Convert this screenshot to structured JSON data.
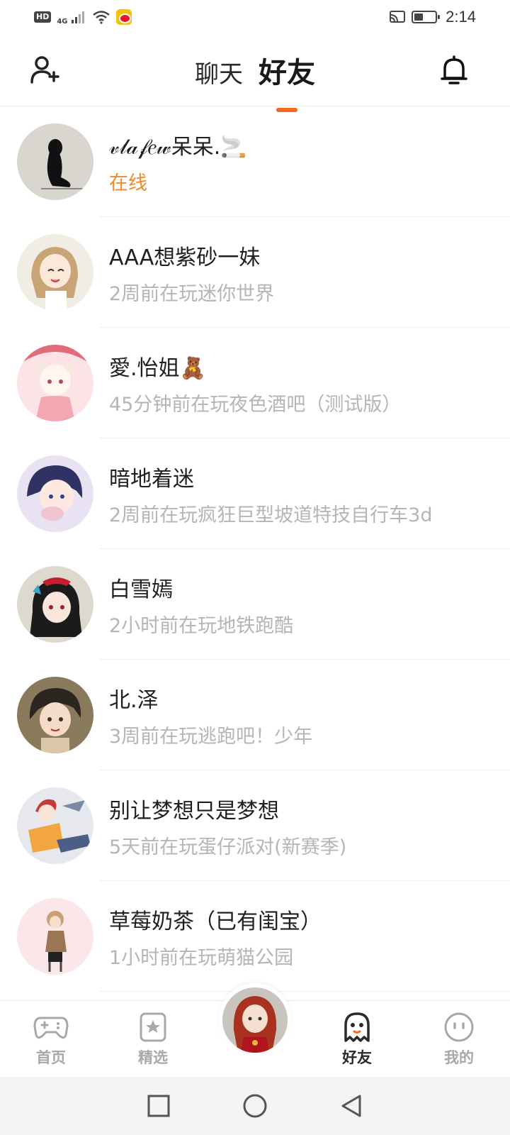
{
  "status_bar": {
    "hd": "HD",
    "network": "4G",
    "time": "2:14"
  },
  "header": {
    "tabs": [
      {
        "label": "聊天",
        "active": false
      },
      {
        "label": "好友",
        "active": true
      }
    ],
    "left_icon": "add-friend-icon",
    "right_icon": "bell-icon"
  },
  "friends": [
    {
      "name": "𝓋𝓁𝒶𝒻𝑒𝓌呆呆.🚬",
      "status": "在线",
      "online": true
    },
    {
      "name": "AAA想紫砂一妹",
      "status": "2周前在玩迷你世界",
      "online": false
    },
    {
      "name": "愛.怡姐🧸",
      "status": "45分钟前在玩夜色酒吧（测试版）",
      "online": false
    },
    {
      "name": "暗地着迷",
      "status": "2周前在玩疯狂巨型坡道特技自行车3d",
      "online": false
    },
    {
      "name": "白雪嫣",
      "status": "2小时前在玩地铁跑酷",
      "online": false
    },
    {
      "name": "北.泽",
      "status": "3周前在玩逃跑吧！少年",
      "online": false
    },
    {
      "name": "别让梦想只是梦想",
      "status": "5天前在玩蛋仔派对(新赛季)",
      "online": false
    },
    {
      "name": "草莓奶茶（已有闺宝）",
      "status": "1小时前在玩萌猫公园",
      "online": false
    }
  ],
  "bottom_nav": [
    {
      "label": "首页",
      "icon": "gamepad-icon",
      "active": false
    },
    {
      "label": "精选",
      "icon": "star-badge-icon",
      "active": false
    },
    {
      "label": "好友",
      "icon": "ghost-icon",
      "active": true
    },
    {
      "label": "我的",
      "icon": "smiley-icon",
      "active": false
    }
  ],
  "colors": {
    "accent": "#f26b21",
    "online": "#f08a24",
    "secondary_text": "#b5b5b5"
  }
}
